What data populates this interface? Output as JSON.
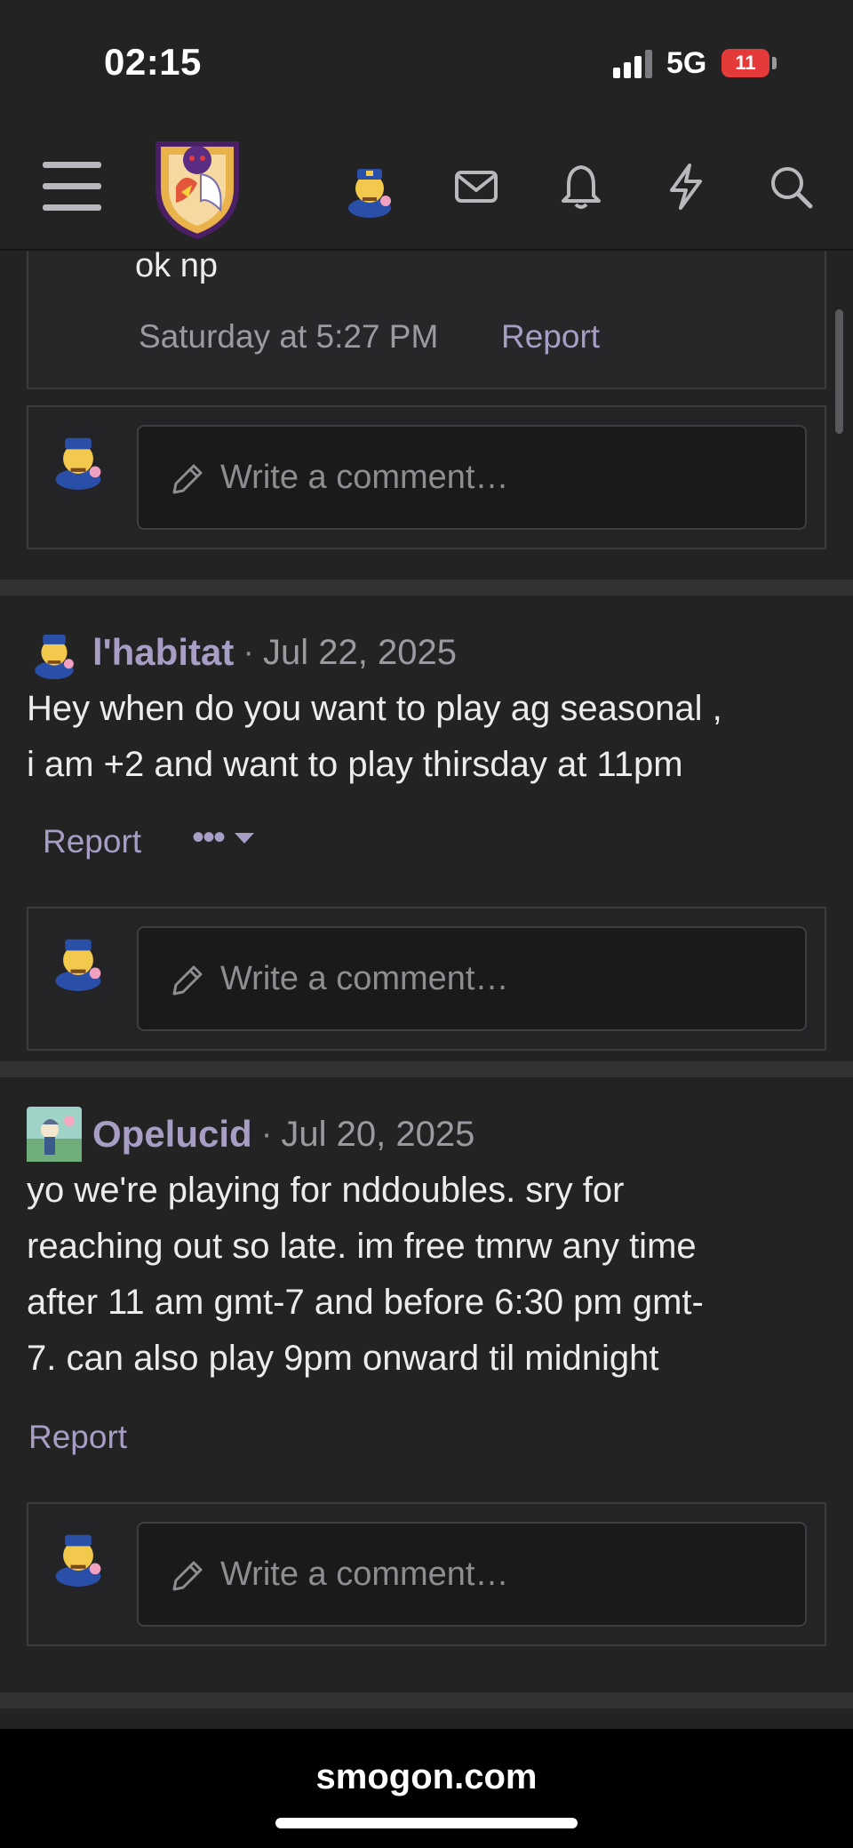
{
  "status_bar": {
    "time": "02:15",
    "network": "5G",
    "battery": "11"
  },
  "header": {
    "site": "smogon"
  },
  "first_comment": {
    "text": "ok np",
    "timestamp": "Saturday at 5:27 PM",
    "report_label": "Report"
  },
  "comment_placeholder": "Write a comment…",
  "posts": [
    {
      "author": "l'habitat",
      "separator": "·",
      "date": "Jul 22, 2025",
      "text_lines": [
        "Hey when do you want to play ag seasonal ,",
        "i am +2 and want to play thirsday at 11pm"
      ],
      "report_label": "Report",
      "more_label": "•••"
    },
    {
      "author": "Opelucid",
      "separator": "·",
      "date": "Jul 20, 2025",
      "text_lines": [
        "yo we're playing for nddoubles. sry for",
        "reaching out so late. im free tmrw any time",
        "after 11 am gmt-7 and before 6:30 pm gmt-",
        "7. can also play 9pm onward til midnight"
      ],
      "report_label": "Report"
    }
  ],
  "bottom_bar": {
    "url": "smogon.com"
  },
  "colors": {
    "background": "#1c1c1d",
    "panel": "#232324",
    "accent_link": "#a89dc4",
    "text": "#ececef",
    "muted": "#9a9aa0"
  }
}
